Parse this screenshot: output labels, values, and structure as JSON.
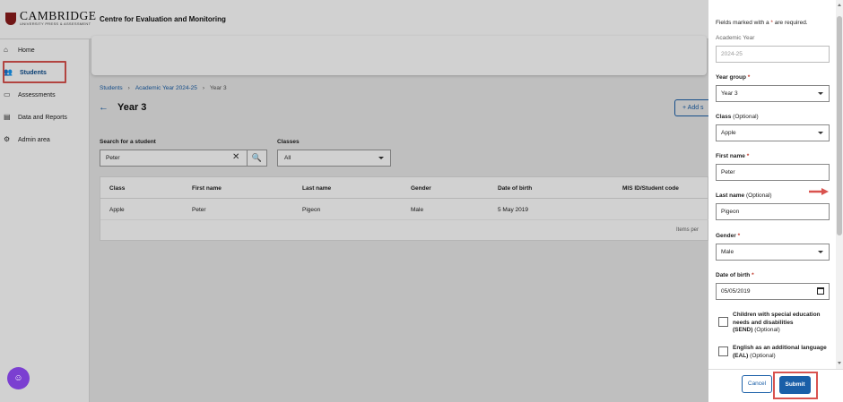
{
  "header": {
    "logo_text": "CAMBRIDGE",
    "logo_tagline": "UNIVERSITY PRESS & ASSESSMENT",
    "site_title": "Centre for Evaluation and Monitoring"
  },
  "sidebar": {
    "items": [
      {
        "label": "Home",
        "icon": "home-icon"
      },
      {
        "label": "Students",
        "icon": "users-icon"
      },
      {
        "label": "Assessments",
        "icon": "assessment-icon"
      },
      {
        "label": "Data and Reports",
        "icon": "reports-icon"
      },
      {
        "label": "Admin area",
        "icon": "admin-icon"
      }
    ],
    "active": "Students"
  },
  "breadcrumb": {
    "items": [
      "Students",
      "Academic Year 2024-25",
      "Year 3"
    ]
  },
  "page": {
    "title": "Year 3",
    "add_button": "Add s"
  },
  "search": {
    "label": "Search for a student",
    "value": "Peter"
  },
  "classes_filter": {
    "label": "Classes",
    "value": "All"
  },
  "table": {
    "columns": [
      "Class",
      "First name",
      "Last name",
      "Gender",
      "Date of birth",
      "MIS ID/Student code"
    ],
    "rows": [
      [
        "Apple",
        "Peter",
        "Pigeon",
        "Male",
        "5 May 2019",
        ""
      ]
    ],
    "items_per_page_label": "Items per"
  },
  "form": {
    "required_note_prefix": "Fields marked with a ",
    "required_star": "*",
    "required_note_suffix": " are required.",
    "academic_year": {
      "label": "Academic Year",
      "value": "2024-25"
    },
    "year_group": {
      "label": "Year group",
      "value": "Year 3"
    },
    "class": {
      "label": "Class",
      "optional": "(Optional)",
      "value": "Apple"
    },
    "first_name": {
      "label": "First name",
      "value": "Peter"
    },
    "last_name": {
      "label": "Last name",
      "optional": "(Optional)",
      "value": "Pigeon"
    },
    "gender": {
      "label": "Gender",
      "value": "Male"
    },
    "date_of_birth": {
      "label": "Date of birth",
      "value": "05/05/2019"
    },
    "send": {
      "label": "Children with special education needs and disabilities",
      "abbr": "(SEND)",
      "optional": "(Optional)"
    },
    "eal": {
      "label": "English as an additional language",
      "abbr": "(EAL)",
      "optional": "(Optional)"
    },
    "cancel_label": "Cancel",
    "submit_label": "Submit"
  },
  "colors": {
    "primary": "#1a5fa8",
    "highlight": "#d9534f",
    "chat": "#7b3fd1"
  }
}
